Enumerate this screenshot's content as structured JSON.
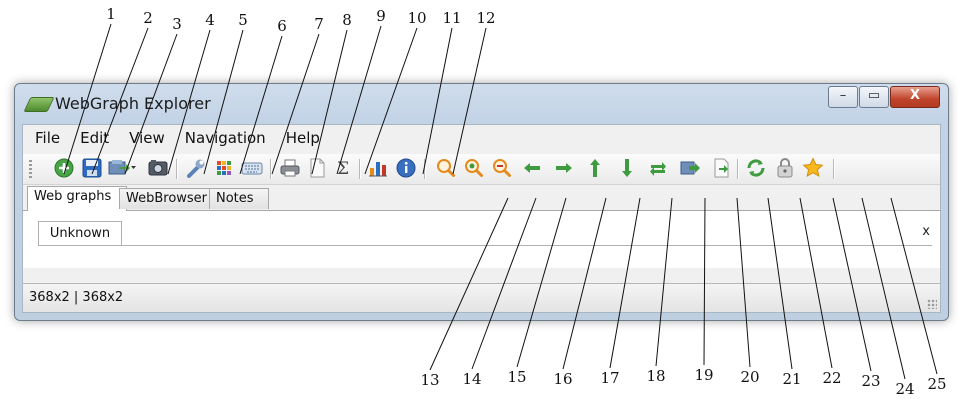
{
  "window": {
    "title": "WebGraph Explorer"
  },
  "window_buttons": {
    "minimize": "–",
    "maximize": "▭",
    "close": "X"
  },
  "menu": [
    "File",
    "Edit",
    "View",
    "Navigation",
    "Help"
  ],
  "tabs": [
    "Web graphs",
    "WebBrowser",
    "Notes"
  ],
  "subtabs": {
    "label": "Unknown",
    "close": "x"
  },
  "status": {
    "text": "368x2  |  368x2"
  },
  "callouts": [
    "1",
    "2",
    "3",
    "4",
    "5",
    "6",
    "7",
    "8",
    "9",
    "10",
    "11",
    "12",
    "13",
    "14",
    "15",
    "16",
    "17",
    "18",
    "19",
    "20",
    "21",
    "22",
    "23",
    "24",
    "25"
  ],
  "toolbar_icons": [
    "add-icon",
    "save-icon",
    "export-dropdown-icon",
    "screenshot-icon",
    "wrench-icon",
    "color-grid-icon",
    "keyboard-icon",
    "print-icon",
    "blank-page-icon",
    "sigma-icon",
    "bar-chart-icon",
    "info-icon",
    "zoom-icon",
    "zoom-in-icon",
    "zoom-out-icon",
    "arrow-left-icon",
    "arrow-right-icon",
    "arrow-up-icon",
    "arrow-down-icon",
    "swap-icon",
    "forward-page-icon",
    "next-page-icon",
    "refresh-icon",
    "lock-icon",
    "star-icon"
  ],
  "colors": {
    "green": "#3f9b3f",
    "blue": "#2a6fc0",
    "orange": "#e58a1c",
    "star": "#f6b81d",
    "close_red": "#c1442c"
  }
}
